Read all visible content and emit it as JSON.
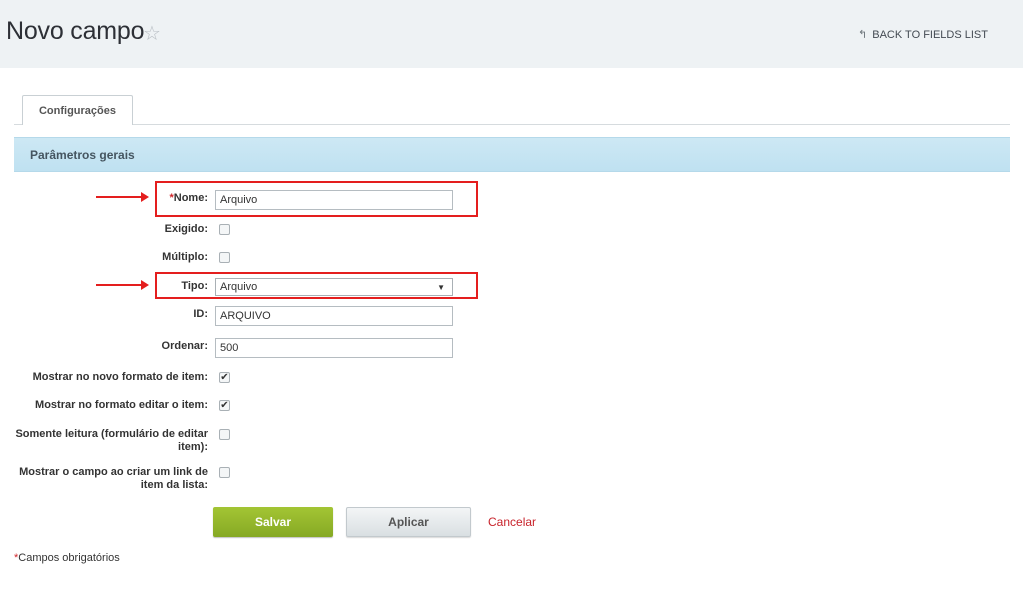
{
  "header": {
    "title": "Novo campo",
    "star_icon": "☆",
    "back_icon": "↰",
    "back_label": "BACK TO FIELDS LIST"
  },
  "tabs": [
    {
      "label": "Configurações"
    }
  ],
  "section": {
    "title": "Parâmetros gerais"
  },
  "form": {
    "nome": {
      "required_mark": "*",
      "label": "Nome:",
      "value": "Arquivo"
    },
    "exigido": {
      "label": "Exigido:",
      "checked": false
    },
    "multiplo": {
      "label": "Múltiplo:",
      "checked": false
    },
    "tipo": {
      "label": "Tipo:",
      "value": "Arquivo",
      "arrow": "▼"
    },
    "id": {
      "label": "ID:",
      "value": "ARQUIVO"
    },
    "ordenar": {
      "label": "Ordenar:",
      "value": "500"
    },
    "mostrar_novo": {
      "label": "Mostrar no novo formato de item:",
      "checked": true
    },
    "mostrar_editar": {
      "label": "Mostrar no formato editar o item:",
      "checked": true
    },
    "somente_leitura": {
      "label": "Somente leitura (formulário de editar item):",
      "checked": false
    },
    "mostrar_link": {
      "label": "Mostrar o campo ao criar um link de item da lista:",
      "checked": false
    }
  },
  "buttons": {
    "save_label": "Salvar",
    "apply_label": "Aplicar",
    "cancel_label": "Cancelar"
  },
  "footer": {
    "required_mark": "*",
    "note": "Campos obrigatórios"
  },
  "colors": {
    "annotation_red": "#e41e1e",
    "save_green": "#94b82c",
    "section_blue": "#c7e5f3",
    "cancel_red": "#c8232b"
  }
}
